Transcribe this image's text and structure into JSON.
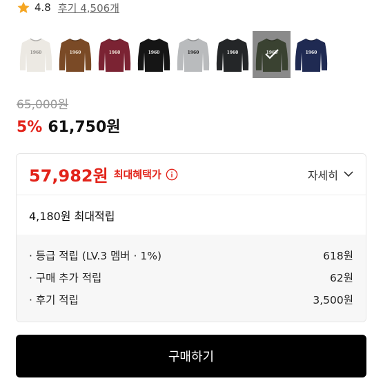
{
  "rating": {
    "icon": "star-icon",
    "score": "4.8",
    "reviews": "후기 4,506개",
    "star_color": "#f5a623"
  },
  "swatches": [
    {
      "color": "#ece9e3",
      "logo": "1960",
      "logo_color": "#8d8a86"
    },
    {
      "color": "#7a4a26",
      "logo": "1960",
      "logo_color": "#f1e7da"
    },
    {
      "color": "#7b2333",
      "logo": "1960",
      "logo_color": "#f1e7da"
    },
    {
      "color": "#151515",
      "logo": "1960",
      "logo_color": "#f2f2f2"
    },
    {
      "color": "#b9bbbd",
      "logo": "1960",
      "logo_color": "#202020"
    },
    {
      "color": "#242628",
      "logo": "1960",
      "logo_color": "#f2f2f2"
    },
    {
      "color": "#3a4231",
      "logo": "1960",
      "logo_color": "#e9e9e9",
      "selected": true
    },
    {
      "color": "#1f2a52",
      "logo": "1960",
      "logo_color": "#f1f1f1"
    }
  ],
  "price": {
    "original": "65,000원",
    "discount": "5%",
    "sale": "61,750원"
  },
  "benefit": {
    "max_price": "57,982원",
    "max_label": "최대혜택가",
    "info_icon": "info-icon",
    "detail_label": "자세히",
    "chevron_icon": "chevron-down-icon",
    "points": "4,180원 최대적립",
    "items": [
      {
        "label": "· 등급 적립 (LV.3 멤버 · 1%)",
        "value": "618원"
      },
      {
        "label": "· 구매 추가 적립",
        "value": "62원"
      },
      {
        "label": "· 후기 적립",
        "value": "3,500원"
      }
    ]
  },
  "buy_button": "구매하기",
  "colors": {
    "accent_red": "#e2231a",
    "button_black": "#000000"
  }
}
